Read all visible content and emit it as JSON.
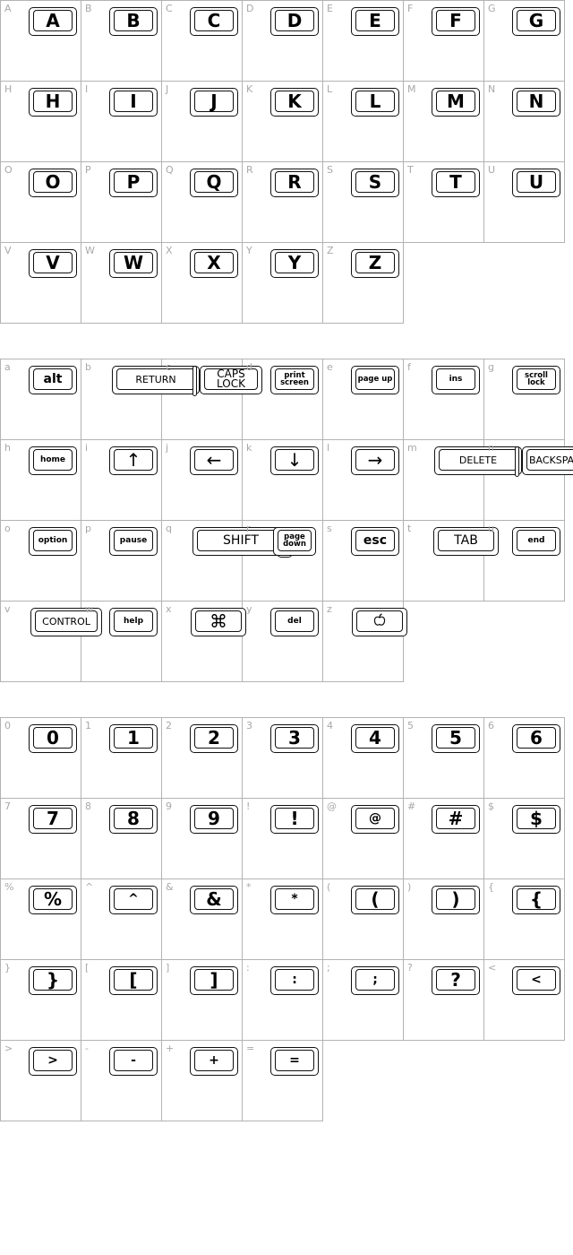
{
  "sections": [
    {
      "name": "uppercase",
      "cells": [
        {
          "label": "A",
          "key": "A"
        },
        {
          "label": "B",
          "key": "B"
        },
        {
          "label": "C",
          "key": "C"
        },
        {
          "label": "D",
          "key": "D"
        },
        {
          "label": "E",
          "key": "E"
        },
        {
          "label": "F",
          "key": "F"
        },
        {
          "label": "G",
          "key": "G"
        },
        {
          "label": "H",
          "key": "H"
        },
        {
          "label": "I",
          "key": "I"
        },
        {
          "label": "J",
          "key": "J"
        },
        {
          "label": "K",
          "key": "K"
        },
        {
          "label": "L",
          "key": "L"
        },
        {
          "label": "M",
          "key": "M"
        },
        {
          "label": "N",
          "key": "N"
        },
        {
          "label": "O",
          "key": "O"
        },
        {
          "label": "P",
          "key": "P"
        },
        {
          "label": "Q",
          "key": "Q"
        },
        {
          "label": "R",
          "key": "R"
        },
        {
          "label": "S",
          "key": "S"
        },
        {
          "label": "T",
          "key": "T"
        },
        {
          "label": "U",
          "key": "U"
        },
        {
          "label": "V",
          "key": "V"
        },
        {
          "label": "W",
          "key": "W"
        },
        {
          "label": "X",
          "key": "X"
        },
        {
          "label": "Y",
          "key": "Y"
        },
        {
          "label": "Z",
          "key": "Z"
        }
      ]
    },
    {
      "name": "lowercase",
      "cells": [
        {
          "label": "a",
          "key": "alt"
        },
        {
          "label": "b",
          "key": "RETURN"
        },
        {
          "label": "c",
          "key": "CAPS LOCK"
        },
        {
          "label": "d",
          "key": "print screen"
        },
        {
          "label": "e",
          "key": "page up"
        },
        {
          "label": "f",
          "key": "ins"
        },
        {
          "label": "g",
          "key": "scroll lock"
        },
        {
          "label": "h",
          "key": "home"
        },
        {
          "label": "i",
          "key": "↑"
        },
        {
          "label": "j",
          "key": "←"
        },
        {
          "label": "k",
          "key": "↓"
        },
        {
          "label": "l",
          "key": "→"
        },
        {
          "label": "m",
          "key": "DELETE"
        },
        {
          "label": "n",
          "key": "BACKSPACE"
        },
        {
          "label": "o",
          "key": "option"
        },
        {
          "label": "p",
          "key": "pause"
        },
        {
          "label": "q",
          "key": "SHIFT"
        },
        {
          "label": "r",
          "key": "page down"
        },
        {
          "label": "s",
          "key": "esc"
        },
        {
          "label": "t",
          "key": "TAB"
        },
        {
          "label": "u",
          "key": "end"
        },
        {
          "label": "v",
          "key": "CONTROL"
        },
        {
          "label": "w",
          "key": "help"
        },
        {
          "label": "x",
          "key": "⌘"
        },
        {
          "label": "y",
          "key": "del"
        },
        {
          "label": "z",
          "key": ""
        }
      ]
    },
    {
      "name": "numbers-symbols",
      "cells": [
        {
          "label": "0",
          "key": "0"
        },
        {
          "label": "1",
          "key": "1"
        },
        {
          "label": "2",
          "key": "2"
        },
        {
          "label": "3",
          "key": "3"
        },
        {
          "label": "4",
          "key": "4"
        },
        {
          "label": "5",
          "key": "5"
        },
        {
          "label": "6",
          "key": "6"
        },
        {
          "label": "7",
          "key": "7"
        },
        {
          "label": "8",
          "key": "8"
        },
        {
          "label": "9",
          "key": "9"
        },
        {
          "label": "!",
          "key": "!"
        },
        {
          "label": "@",
          "key": "@"
        },
        {
          "label": "#",
          "key": "#"
        },
        {
          "label": "$",
          "key": "$"
        },
        {
          "label": "%",
          "key": "%"
        },
        {
          "label": "^",
          "key": "^"
        },
        {
          "label": "&",
          "key": "&"
        },
        {
          "label": "*",
          "key": "*"
        },
        {
          "label": "(",
          "key": "("
        },
        {
          "label": ")",
          "key": ")"
        },
        {
          "label": "{",
          "key": "{"
        },
        {
          "label": "}",
          "key": "}"
        },
        {
          "label": "[",
          "key": "["
        },
        {
          "label": "]",
          "key": "]"
        },
        {
          "label": ":",
          "key": ":"
        },
        {
          "label": ";",
          "key": ";"
        },
        {
          "label": "?",
          "key": "?"
        },
        {
          "label": "<",
          "key": "<"
        },
        {
          "label": ">",
          "key": ">"
        },
        {
          "label": "-",
          "key": "-"
        },
        {
          "label": "+",
          "key": "+"
        },
        {
          "label": "=",
          "key": "="
        }
      ]
    }
  ],
  "icons": {
    "z": "apple-logo-icon",
    "x": "command-icon"
  }
}
